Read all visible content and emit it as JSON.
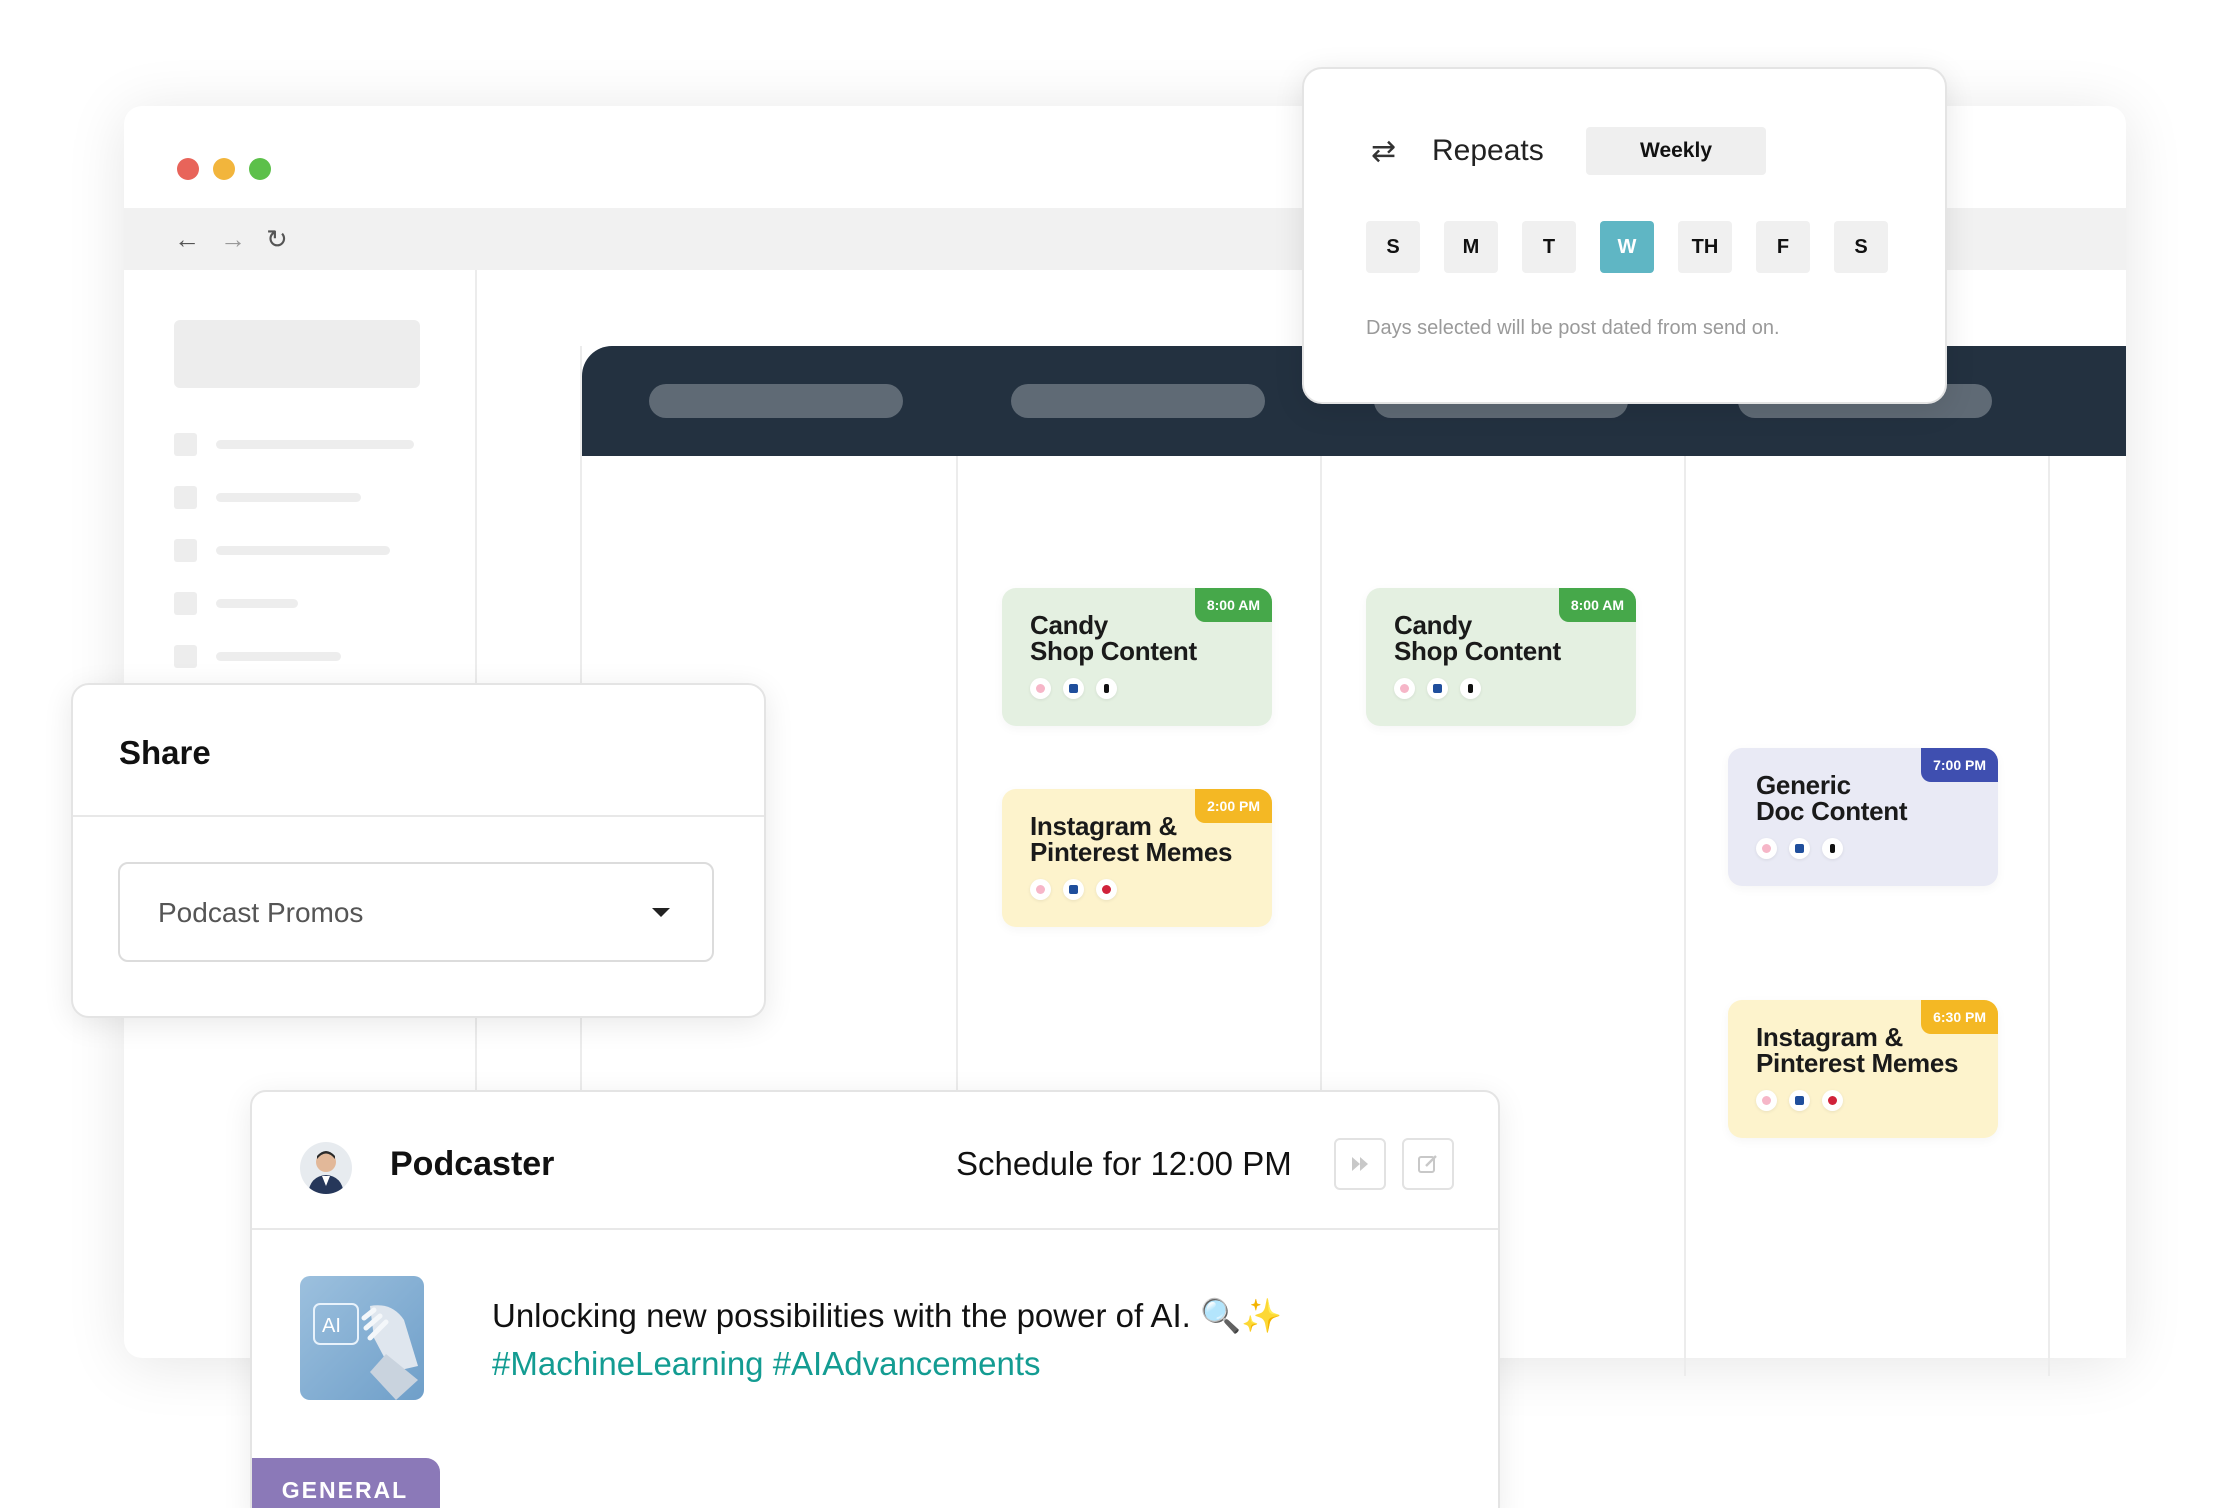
{
  "repeats": {
    "label": "Repeats",
    "frequency": "Weekly",
    "days": [
      "S",
      "M",
      "T",
      "W",
      "TH",
      "F",
      "S"
    ],
    "selected_day": "W",
    "hint": "Days selected will be post dated from send on."
  },
  "share": {
    "title": "Share",
    "selected": "Podcast Promos"
  },
  "calendar": {
    "cards": [
      {
        "title_line1": "Candy",
        "title_line2": "Shop Content",
        "time": "8:00 AM",
        "color": "#46a84a"
      },
      {
        "title_line1": "Instagram &",
        "title_line2": "Pinterest Memes",
        "time": "2:00 PM",
        "color": "#f4b824"
      },
      {
        "title_line1": "Candy",
        "title_line2": "Shop Content",
        "time": "8:00 AM",
        "color": "#46a84a"
      },
      {
        "title_line1": "Generic",
        "title_line2": "Doc Content",
        "time": "7:00 PM",
        "color": "#3f4fb0"
      },
      {
        "title_line1": "Instagram &",
        "title_line2": "Pinterest Memes",
        "time": "6:30 PM",
        "color": "#f4b824"
      }
    ]
  },
  "post": {
    "user": "Podcaster",
    "schedule": "Schedule for 12:00 PM",
    "text": "Unlocking new possibilities with the power of AI. 🔍✨",
    "hashtags": "#MachineLearning #AIAdvancements",
    "badge": "GENERAL",
    "thumb_label": "AI"
  },
  "colors": {
    "dot_red": "#e8645a",
    "dot_yellow": "#f2b53c",
    "dot_green": "#5cc04a",
    "calendar_header": "#233140",
    "selected_day": "#5fb6c4",
    "hashtag": "#139c92",
    "badge": "#8b79b8"
  }
}
